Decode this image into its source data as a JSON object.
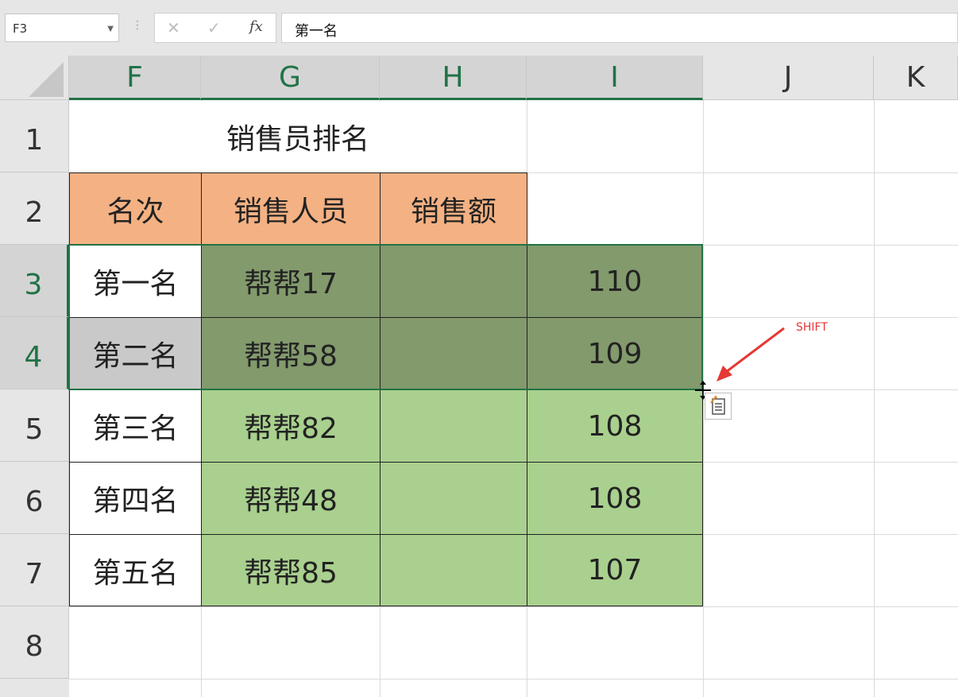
{
  "formula_bar": {
    "name_box": "F3",
    "cancel_icon": "✕",
    "confirm_icon": "✓",
    "fx_label": "fx",
    "value": "第一名"
  },
  "columns": [
    "F",
    "G",
    "H",
    "I",
    "J",
    "K"
  ],
  "rows": [
    "1",
    "2",
    "3",
    "4",
    "5",
    "6",
    "7",
    "8"
  ],
  "title": "销售员排名",
  "headers": {
    "rank": "名次",
    "person": "销售人员",
    "amount": "销售额"
  },
  "data_rows": [
    {
      "rank": "第一名",
      "person": "帮帮17",
      "amount": "",
      "value": "110"
    },
    {
      "rank": "第二名",
      "person": "帮帮58",
      "amount": "",
      "value": "109"
    },
    {
      "rank": "第三名",
      "person": "帮帮82",
      "amount": "",
      "value": "108"
    },
    {
      "rank": "第四名",
      "person": "帮帮48",
      "amount": "",
      "value": "108"
    },
    {
      "rank": "第五名",
      "person": "帮帮85",
      "amount": "",
      "value": "107"
    }
  ],
  "annotation": "SHIFT",
  "colors": {
    "header_fill": "#f4b183",
    "green": "#a9d08e",
    "green_selected": "#829a6c",
    "accent": "#217346",
    "annotation": "#e53935"
  }
}
